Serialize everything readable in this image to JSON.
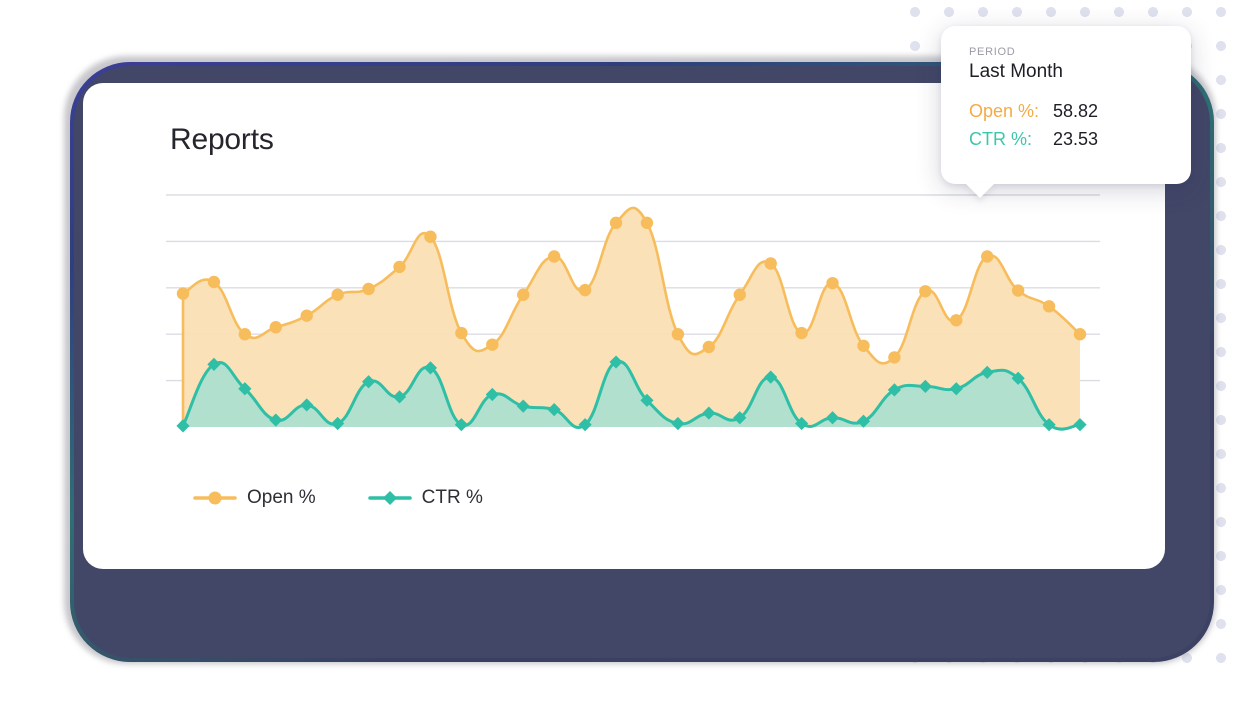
{
  "card": {
    "title": "Reports"
  },
  "tooltip": {
    "period_label": "PERIOD",
    "period_value": "Last Month",
    "rows": [
      {
        "key": "Open %:",
        "value": "58.82",
        "color": "#f3ab46"
      },
      {
        "key": "CTR %:",
        "value": "23.53",
        "color": "#3bc6ad"
      }
    ]
  },
  "legend": [
    {
      "label": "Open %",
      "color": "#f7bd5c",
      "marker": "circle-marker-icon"
    },
    {
      "label": "CTR %",
      "color": "#2fbfa6",
      "marker": "diamond-marker-icon"
    }
  ],
  "theme": {
    "frame": "#424768",
    "card": "#ffffff",
    "dot": "#dfe1ee",
    "gridline": "#dcdde2",
    "open_line": "#f7bd5c",
    "open_fill": "#fbdfb3",
    "ctr_line": "#2fbfa6",
    "ctr_fill": "#abdfcf"
  },
  "chart_data": {
    "type": "area",
    "title": "Reports",
    "xlabel": "",
    "ylabel": "",
    "grid": true,
    "legend_position": "bottom-left",
    "ylim": [
      0,
      100
    ],
    "gridline_count": 5,
    "x": [
      1,
      2,
      3,
      4,
      5,
      6,
      7,
      8,
      9,
      10,
      11,
      12,
      13,
      14,
      15,
      16,
      17,
      18,
      19,
      20,
      21,
      22,
      23,
      24,
      25,
      26,
      27,
      28,
      29,
      30
    ],
    "series": [
      {
        "name": "Open %",
        "color": "#f7bd5c",
        "fill": "#fbdfb3",
        "marker": "circle",
        "values": [
          57.5,
          62.5,
          40.0,
          43.0,
          48.0,
          57.0,
          59.5,
          69.0,
          82.0,
          40.5,
          35.5,
          57.0,
          73.5,
          59.0,
          88.0,
          88.0,
          40.0,
          34.5,
          57.0,
          70.5,
          40.5,
          62.0,
          35.0,
          30.0,
          58.5,
          46.0,
          73.5,
          58.82,
          52.0,
          40.0
        ]
      },
      {
        "name": "CTR %",
        "color": "#2fbfa6",
        "fill": "#abdfcf",
        "marker": "diamond",
        "values": [
          0.5,
          27.0,
          16.5,
          3.0,
          9.5,
          1.5,
          19.5,
          13.0,
          25.5,
          1.0,
          14.0,
          9.0,
          7.5,
          1.0,
          28.0,
          11.5,
          1.5,
          6.0,
          4.0,
          21.5,
          1.5,
          4.0,
          2.5,
          16.0,
          17.5,
          16.5,
          23.53,
          21.0,
          1.0,
          1.0
        ]
      }
    ]
  }
}
